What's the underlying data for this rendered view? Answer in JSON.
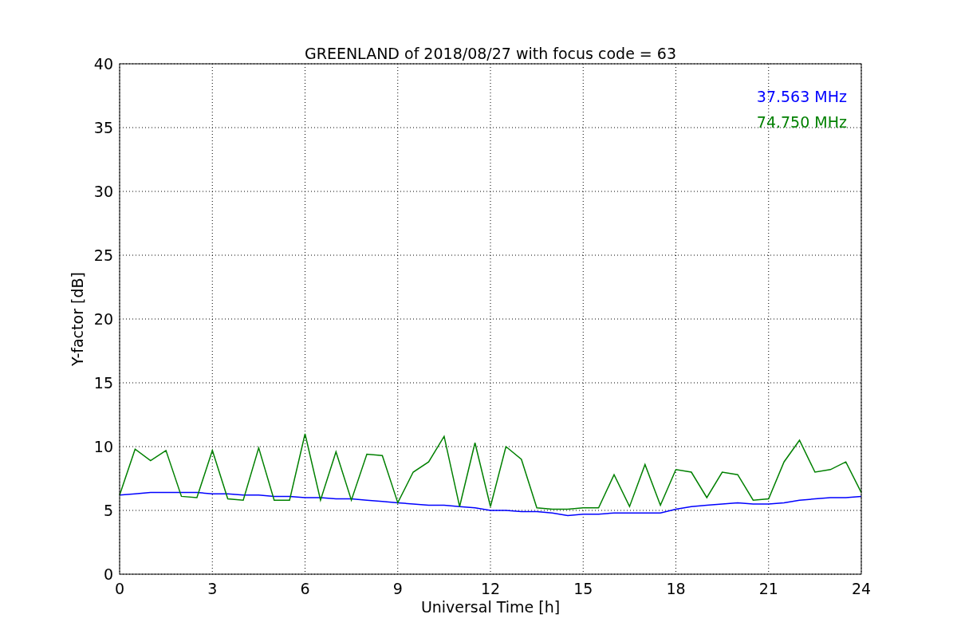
{
  "figure": {
    "chart_data": {
      "type": "line",
      "title": "GREENLAND of 2018/08/27 with focus code = 63",
      "xlabel": "Universal Time [h]",
      "ylabel": "Y-factor [dB]",
      "x": [
        0,
        0.5,
        1,
        1.5,
        2,
        2.5,
        3,
        3.5,
        4,
        4.5,
        5,
        5.5,
        6,
        6.5,
        7,
        7.5,
        8,
        8.5,
        9,
        9.5,
        10,
        10.5,
        11,
        11.5,
        12,
        12.5,
        13,
        13.5,
        14,
        14.5,
        15,
        15.5,
        16,
        16.5,
        17,
        17.5,
        18,
        18.5,
        19,
        19.5,
        20,
        20.5,
        21,
        21.5,
        22,
        22.5,
        23,
        23.5,
        24
      ],
      "series": [
        {
          "name": "37.563 MHz",
          "color": "#0000ff",
          "values": [
            6.2,
            6.3,
            6.4,
            6.4,
            6.4,
            6.4,
            6.3,
            6.3,
            6.2,
            6.2,
            6.1,
            6.1,
            6.0,
            6.0,
            5.9,
            5.9,
            5.8,
            5.7,
            5.6,
            5.5,
            5.4,
            5.4,
            5.3,
            5.2,
            5.0,
            5.0,
            4.9,
            4.9,
            4.8,
            4.6,
            4.7,
            4.7,
            4.8,
            4.8,
            4.8,
            4.8,
            5.1,
            5.3,
            5.4,
            5.5,
            5.6,
            5.5,
            5.5,
            5.6,
            5.8,
            5.9,
            6.0,
            6.0,
            6.1
          ]
        },
        {
          "name": "74.750 MHz",
          "color": "#008000",
          "values": [
            6.2,
            9.8,
            8.9,
            9.7,
            6.1,
            6.0,
            9.7,
            5.9,
            5.8,
            9.9,
            5.8,
            5.8,
            11.0,
            5.8,
            9.6,
            5.8,
            9.4,
            9.3,
            5.6,
            8.0,
            8.8,
            10.8,
            5.3,
            10.3,
            5.3,
            10.0,
            9.0,
            5.2,
            5.1,
            5.1,
            5.2,
            5.2,
            7.8,
            5.3,
            8.6,
            5.4,
            8.2,
            8.0,
            6.0,
            8.0,
            7.8,
            5.8,
            5.9,
            8.8,
            10.5,
            8.0,
            8.2,
            8.8,
            6.4
          ]
        }
      ],
      "grid": true,
      "xlim": [
        0,
        24
      ],
      "ylim": [
        0,
        40
      ],
      "xticks": [
        0,
        3,
        6,
        9,
        12,
        15,
        18,
        21,
        24
      ],
      "yticks": [
        0,
        5,
        10,
        15,
        20,
        25,
        30,
        35,
        40
      ]
    }
  }
}
